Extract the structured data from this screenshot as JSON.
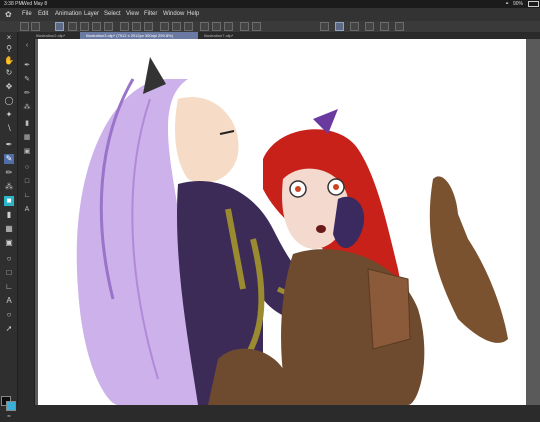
{
  "status_bar": {
    "time": "3:38 PM",
    "date": "Wed May 8",
    "battery": "90%"
  },
  "menu": {
    "items": [
      "File",
      "Edit",
      "Animation",
      "Layer",
      "Select",
      "View",
      "Filter",
      "Window",
      "Help"
    ]
  },
  "tabs": [
    {
      "label": "Illustration2.clip*",
      "active": false
    },
    {
      "label": "Illustration3.clip* (7912 x 2912px 300dpi 299.8%)",
      "active": true
    },
    {
      "label": "Illustration7.clip*",
      "active": false
    }
  ],
  "tools_left": [
    "close-icon",
    "zoom-icon",
    "hand-icon",
    "rotate-icon",
    "move-icon",
    "lasso-icon",
    "magic-wand-icon",
    "eyedropper-icon",
    "pen-icon",
    "pencil-icon",
    "brush-icon",
    "airbrush-icon",
    "blend-icon",
    "eraser-icon",
    "fill-icon",
    "gradient-icon",
    "figure-icon",
    "frame-icon",
    "ruler-icon",
    "text-icon",
    "balloon-icon",
    "correct-line-icon"
  ],
  "tools_sub": [
    "pen-icon",
    "pencil-icon",
    "brush-icon",
    "airbrush-icon",
    "eraser-icon",
    "fill-icon",
    "gradient-icon",
    "figure-icon",
    "frame-icon",
    "ruler-icon",
    "text-icon",
    "balloon-icon"
  ],
  "colors": {
    "main": "#0d0d0d",
    "sub": "#3bb0d6",
    "accent": "#4f6ea8",
    "tool_highlight": "#2db5c6"
  },
  "canvas": {
    "zoom": "299.8%"
  }
}
